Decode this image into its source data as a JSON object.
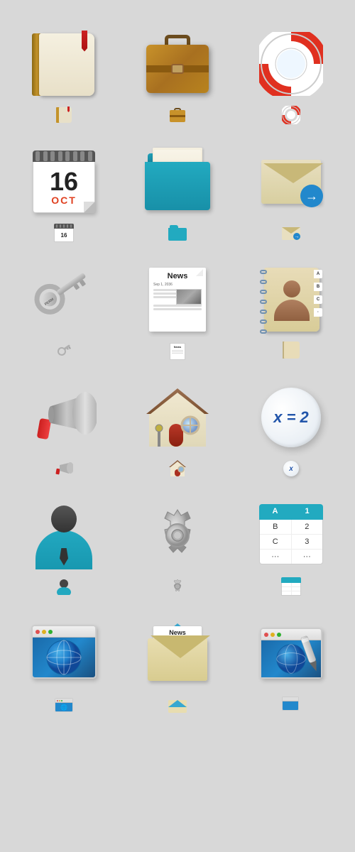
{
  "icons": {
    "rows": [
      {
        "items": [
          {
            "id": "notebook",
            "label": "Notebook",
            "small_label": "notebook-small"
          },
          {
            "id": "suitcase",
            "label": "Suitcase",
            "small_label": "suitcase-small"
          },
          {
            "id": "lifebuoy",
            "label": "Lifebuoy",
            "small_label": "lifebuoy-small"
          }
        ]
      },
      {
        "items": [
          {
            "id": "calendar",
            "label": "Calendar",
            "day": "16",
            "month": "OCT"
          },
          {
            "id": "folder",
            "label": "Folder"
          },
          {
            "id": "email",
            "label": "Email"
          }
        ]
      },
      {
        "items": [
          {
            "id": "key",
            "label": "Key",
            "tag": "PERMISSIONS"
          },
          {
            "id": "news",
            "label": "News"
          },
          {
            "id": "contacts",
            "label": "Contacts"
          }
        ]
      },
      {
        "items": [
          {
            "id": "megaphone",
            "label": "Megaphone"
          },
          {
            "id": "house",
            "label": "Home"
          },
          {
            "id": "math",
            "label": "Math",
            "formula": "x = 2"
          }
        ]
      },
      {
        "items": [
          {
            "id": "user",
            "label": "User"
          },
          {
            "id": "gear",
            "label": "Settings"
          },
          {
            "id": "table",
            "label": "Table"
          }
        ]
      },
      {
        "items": [
          {
            "id": "browser",
            "label": "Browser"
          },
          {
            "id": "news-envelope",
            "label": "News Envelope"
          },
          {
            "id": "web-editor",
            "label": "Web Editor"
          }
        ]
      }
    ],
    "table_data": {
      "headers": [
        "A",
        "1"
      ],
      "rows": [
        [
          "B",
          "2"
        ],
        [
          "C",
          "3"
        ],
        [
          "...",
          "..."
        ]
      ]
    },
    "news_title": "News",
    "news_date": "Sep 1, 2036",
    "math_formula": "x = 2",
    "key_label": "PERMISSIONS"
  }
}
